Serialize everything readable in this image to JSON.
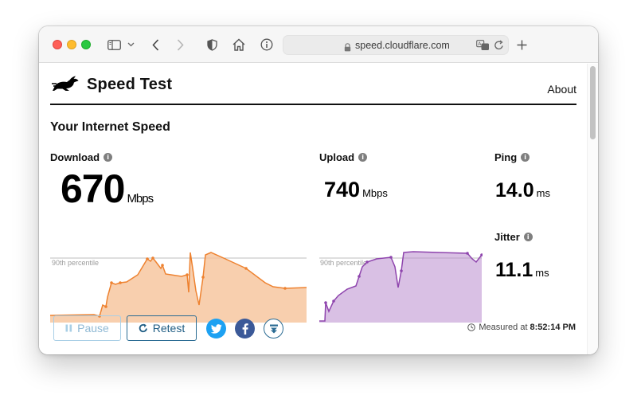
{
  "browser": {
    "url": "speed.cloudflare.com"
  },
  "header": {
    "brand": "Speed Test",
    "about": "About"
  },
  "section": {
    "title": "Your Internet Speed"
  },
  "metrics": {
    "download": {
      "label": "Download",
      "value": "670",
      "unit": "Mbps",
      "percentile_label": "90th percentile",
      "color": "#f38020"
    },
    "upload": {
      "label": "Upload",
      "value": "740",
      "unit": "Mbps",
      "percentile_label": "90th percentile",
      "color": "#9b59b6"
    },
    "ping": {
      "label": "Ping",
      "value": "14.0",
      "unit": "ms"
    },
    "jitter": {
      "label": "Jitter",
      "value": "11.1",
      "unit": "ms"
    }
  },
  "actions": {
    "pause_label": "Pause",
    "retest_label": "Retest"
  },
  "share": {
    "twitter": "twitter-icon",
    "facebook": "facebook-icon",
    "download": "download-icon"
  },
  "status": {
    "measured_label": "Measured at",
    "measured_time": "8:52:14 PM"
  }
}
